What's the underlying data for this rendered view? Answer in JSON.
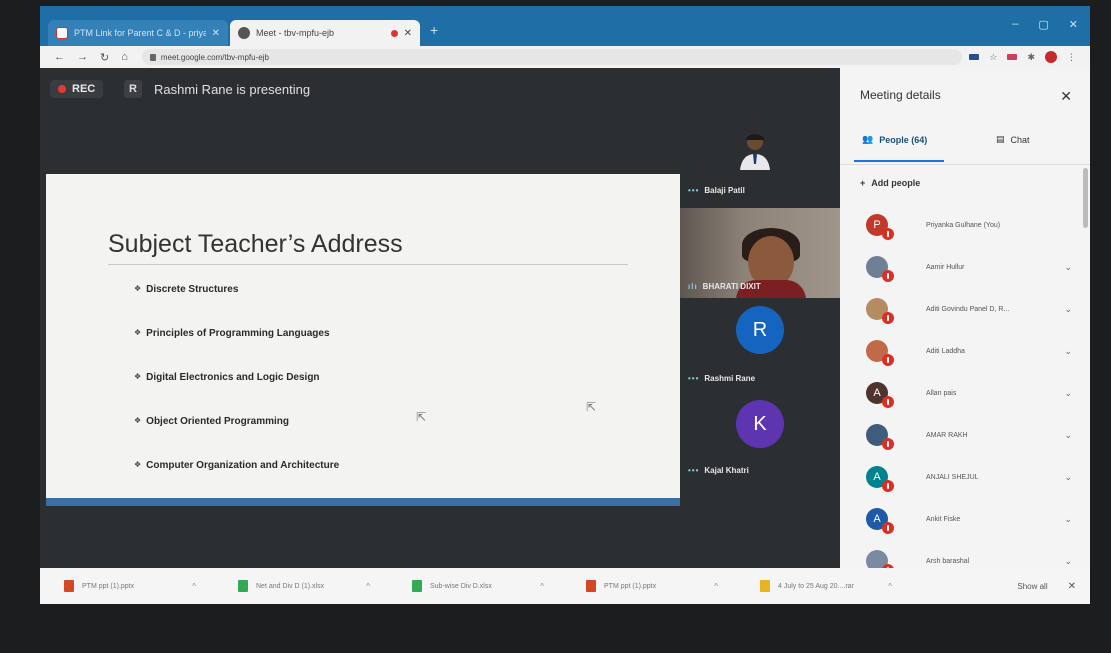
{
  "browser": {
    "tabs": [
      {
        "label": "PTM Link for Parent C & D - priyan",
        "active": false
      },
      {
        "label": "Meet - tbv-mpfu-ejb",
        "active": true
      }
    ],
    "url": "meet.google.com/tbv-mpfu-ejb"
  },
  "meet": {
    "rec_label": "REC",
    "presenter_initial": "R",
    "presenting_text": "Rashmi Rane is presenting"
  },
  "slide": {
    "title": "Subject Teacher’s Address",
    "bullets": [
      "Discrete Structures",
      "Principles of Programming Languages",
      "Digital Electronics and Logic Design",
      "Object Oriented Programming",
      "Computer Organization and Architecture"
    ]
  },
  "tiles": {
    "balaji": "Balaji Patil",
    "bharati": "BHARATI DIXIT",
    "rashmi_initial": "R",
    "rashmi": "Rashmi Rane",
    "kajal_initial": "K",
    "kajal": "Kajal Khatri"
  },
  "panel": {
    "title": "Meeting details",
    "people_tab": "People (64)",
    "chat_tab": "Chat",
    "add_people": "Add people",
    "participants": [
      {
        "initial": "P",
        "name": "Priyanka Gulhane (You)",
        "color": "#c0392b"
      },
      {
        "initial": "",
        "name": "Aamir Hullur",
        "color": "#6f7f94"
      },
      {
        "initial": "",
        "name": "Aditi Govindu Panel D, R...",
        "color": "#b58b62"
      },
      {
        "initial": "",
        "name": "Aditi Laddha",
        "color": "#c06a4a"
      },
      {
        "initial": "A",
        "name": "Allan pais",
        "color": "#4e342e"
      },
      {
        "initial": "",
        "name": "AMAR RAKH",
        "color": "#3e5d7a"
      },
      {
        "initial": "A",
        "name": "ANJALI SHEJUL",
        "color": "#00838f"
      },
      {
        "initial": "A",
        "name": "Ankit Fiske",
        "color": "#1e5aa8"
      },
      {
        "initial": "",
        "name": "Arsh barashal",
        "color": "#7a8aa0"
      }
    ]
  },
  "downloads": {
    "items": [
      "PTM ppt (1).pptx",
      "Net and Div D (1).xlsx",
      "Sub-wise Div D.xlsx",
      "PTM ppt (1).pptx",
      "4 July to 25 Aug 20....rar"
    ],
    "show_all": "Show all"
  },
  "colors": {
    "rec_red": "#e53935",
    "meet_blue": "#1565c0",
    "kajal_purple": "#5d35b1",
    "mic_red": "#d93025"
  }
}
